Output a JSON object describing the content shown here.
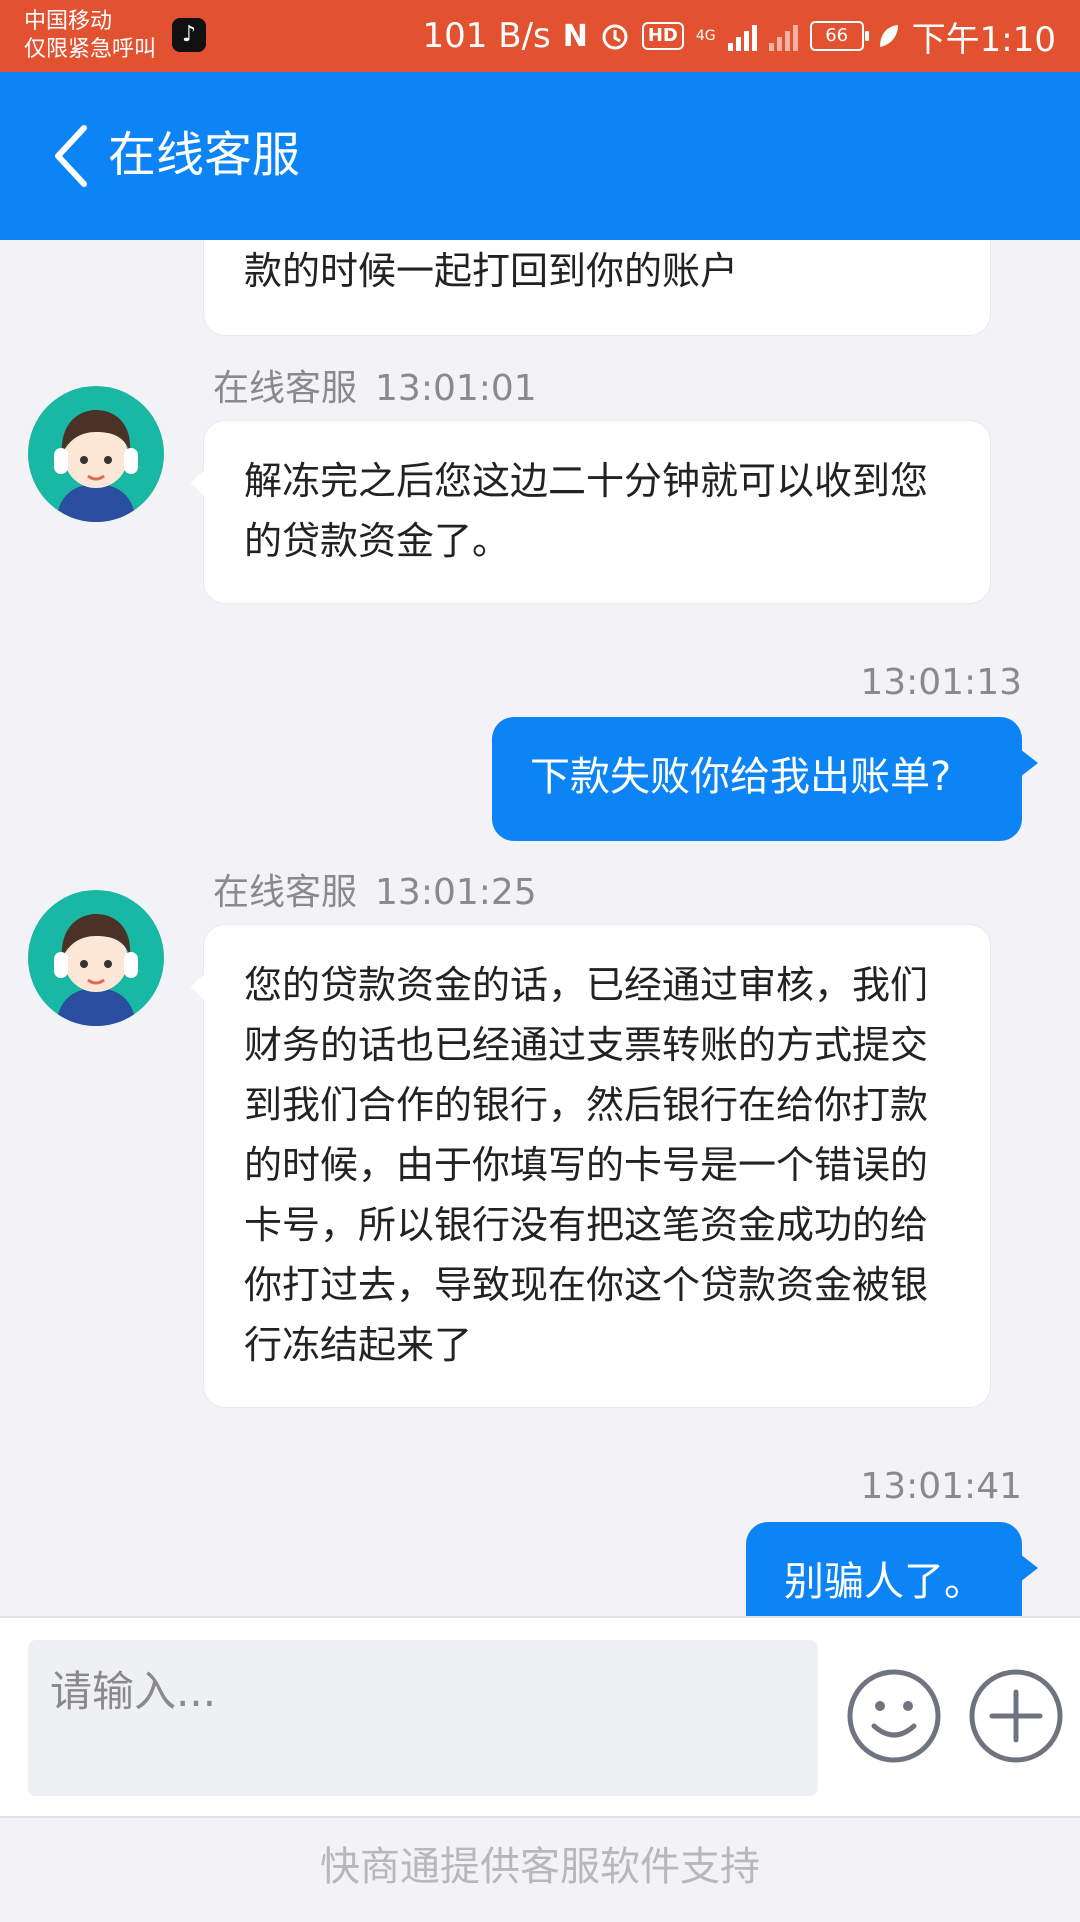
{
  "status_bar": {
    "carrier_line1": "中国移动",
    "carrier_line2": "仅限紧急呼叫",
    "app_icon": "tiktok-icon",
    "net_speed": "101 B/s",
    "nfc": "N",
    "hd": "HD",
    "network": "4G",
    "battery": "66",
    "time": "下午1:10"
  },
  "header": {
    "title": "在线客服",
    "back_icon": "chevron-left-icon"
  },
  "messages": [
    {
      "direction": "in",
      "text": "款的时候一起打回到你的账户"
    },
    {
      "direction": "in",
      "sender": "在线客服",
      "time": "13:01:01",
      "text": "解冻完之后您这边二十分钟就可以收到您的贷款资金了。"
    },
    {
      "direction": "out",
      "time": "13:01:13",
      "text": "下款失败你给我出账单?"
    },
    {
      "direction": "in",
      "sender": "在线客服",
      "time": "13:01:25",
      "text": "您的贷款资金的话，已经通过审核，我们财务的话也已经通过支票转账的方式提交到我们合作的银行，然后银行在给你打款的时候，由于你填写的卡号是一个错误的卡号，所以银行没有把这笔资金成功的给你打过去，导致现在你这个贷款资金被银行冻结起来了"
    },
    {
      "direction": "out",
      "time": "13:01:41",
      "text": "别骗人了。"
    }
  ],
  "input": {
    "placeholder": "请输入..."
  },
  "footer": {
    "text": "快商通提供客服软件支持"
  },
  "colors": {
    "status_bar": "#e25230",
    "header": "#0d84f5",
    "outgoing_bubble": "#0d84f5",
    "avatar_bg": "#19b8a4"
  }
}
